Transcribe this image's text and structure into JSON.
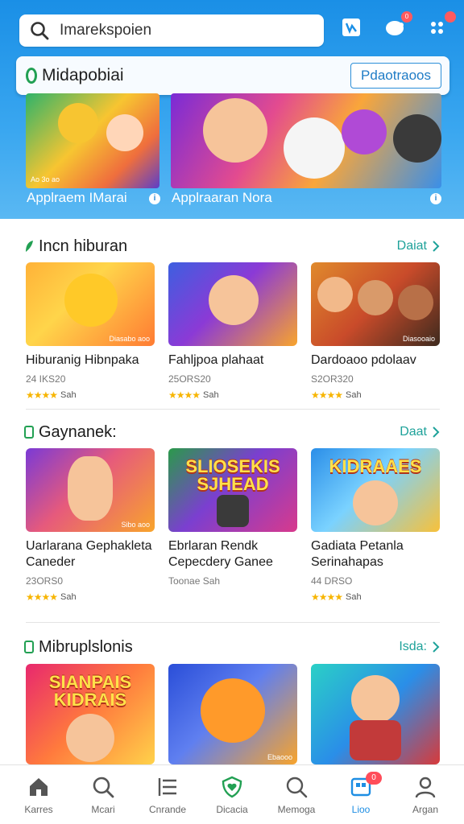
{
  "header": {
    "search_value": "Imarekspoien",
    "store_name": "Midapobiai",
    "store_button": "Pdaotraoos",
    "notification_badge": "0"
  },
  "banners": [
    {
      "label": "Applraem IMarai",
      "tag": "Ao 3o ao"
    },
    {
      "label": "Applraaran Nora",
      "tag": ""
    }
  ],
  "sections": [
    {
      "title": "Incn hiburan",
      "more": "Daiat",
      "cards": [
        {
          "title": "Hiburanig Hibnpaka",
          "meta": "24 IKS20",
          "rating": "Sah",
          "caption": "Diasabo aoo",
          "art": ""
        },
        {
          "title": "Fahljpoa plahaat",
          "meta": "25ORS20",
          "rating": "Sah",
          "caption": "",
          "art": ""
        },
        {
          "title": "Dardoaoo pdolaav",
          "meta": "S2OR320",
          "rating": "Sah",
          "caption": "Diasooaio",
          "art": ""
        }
      ]
    },
    {
      "title": "Gaynanek:",
      "more": "Daat",
      "cards": [
        {
          "title": "Uarlarana Gephakleta Caneder",
          "meta": "23ORS0",
          "rating": "Sah",
          "caption": "Sibo aoo",
          "art": ""
        },
        {
          "title": "Ebrlaran Rendk Cepecdery Ganee",
          "meta": "Toonae Sah",
          "rating": "",
          "caption": "",
          "art": "SLIOSEKIS SJHEAD"
        },
        {
          "title": "Gadiata Petanla Serinahapas",
          "meta": "44 DRSO",
          "rating": "Sah",
          "caption": "",
          "art": "KIDRAAES"
        }
      ]
    },
    {
      "title": "Mibruplslonis",
      "more": "Isda:",
      "cards": [
        {
          "title": "",
          "meta": "",
          "rating": "",
          "caption": "",
          "art": "SIANPAIS KIDRAIS"
        },
        {
          "title": "",
          "meta": "",
          "rating": "",
          "caption": "Ebaooo",
          "art": ""
        },
        {
          "title": "",
          "meta": "",
          "rating": "",
          "caption": "",
          "art": ""
        }
      ]
    }
  ],
  "bottom_nav": [
    {
      "label": "Karres",
      "icon": "home-icon"
    },
    {
      "label": "Mcari",
      "icon": "search-icon"
    },
    {
      "label": "Cnrande",
      "icon": "list-icon"
    },
    {
      "label": "Dicacia",
      "icon": "shield-heart-icon"
    },
    {
      "label": "Memoga",
      "icon": "magnifier-icon"
    },
    {
      "label": "Lioo",
      "icon": "apps-icon",
      "badge": "0"
    },
    {
      "label": "Argan",
      "icon": "profile-icon"
    }
  ],
  "colors": {
    "header_blue": "#1a8fe6",
    "accent_teal": "#1ea29a",
    "active_blue": "#1e8ee3",
    "star": "#f7b500",
    "badge_red": "#ff4d5a"
  }
}
